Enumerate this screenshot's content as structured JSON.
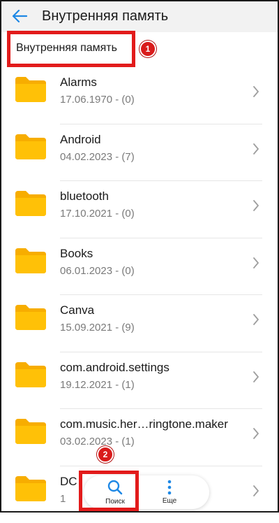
{
  "appbar": {
    "title": "Внутренняя память",
    "back_icon": "arrow-left-icon"
  },
  "breadcrumb": {
    "label": "Внутренняя память"
  },
  "annotations": {
    "badge1": "1",
    "badge2": "2",
    "highlight_color": "#e21b1b"
  },
  "colors": {
    "accent": "#1e88e5",
    "folder": "#ffc107",
    "folder_dark": "#f7ad00"
  },
  "folders": [
    {
      "name": "Alarms",
      "meta": "17.06.1970 - (0)"
    },
    {
      "name": "Android",
      "meta": "04.02.2023 - (7)"
    },
    {
      "name": "bluetooth",
      "meta": "17.10.2021 - (0)"
    },
    {
      "name": "Books",
      "meta": "06.01.2023 - (0)"
    },
    {
      "name": "Canva",
      "meta": "15.09.2021 - (9)"
    },
    {
      "name": "com.android.settings",
      "meta": "19.12.2021 - (1)"
    },
    {
      "name": "com.music.her…ringtone.maker",
      "meta": "03.02.2023 - (1)"
    },
    {
      "name": "DC",
      "meta": "1"
    }
  ],
  "bottom_nav": {
    "search": {
      "label": "Поиск",
      "icon": "search-icon"
    },
    "more": {
      "label": "Еще",
      "icon": "more-vertical-icon"
    }
  }
}
